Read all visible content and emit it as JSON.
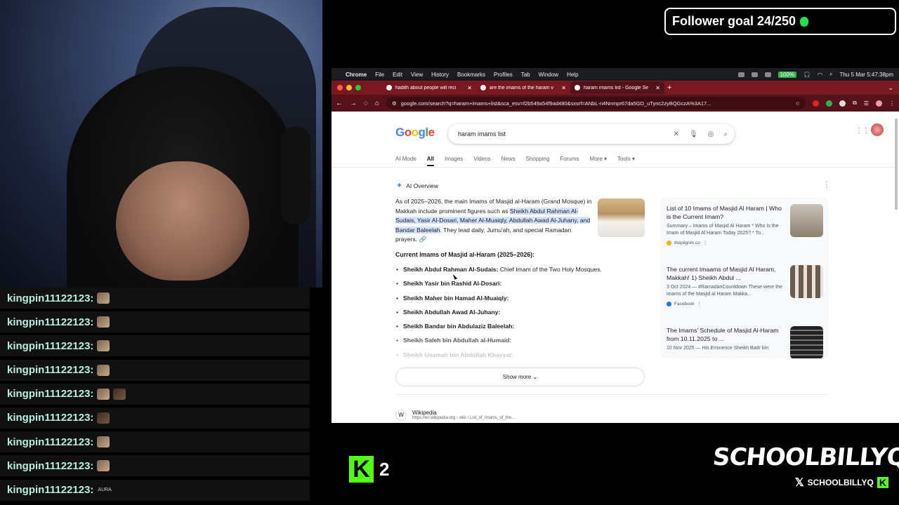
{
  "follower_goal": {
    "label": "Follower goal 24/250",
    "progress": 0.096,
    "color": "#23e04a"
  },
  "chat": {
    "messages": [
      {
        "user": "kingpin11122123:",
        "emote": "face"
      },
      {
        "user": "kingpin11122123:",
        "emote": "face"
      },
      {
        "user": "kingpin11122123:",
        "emote": "face"
      },
      {
        "user": "kingpin11122123:",
        "emote": "face"
      },
      {
        "user": "kingpin11122123:",
        "emote": "face-pair"
      },
      {
        "user": "kingpin11122123:",
        "emote": "dark-face"
      },
      {
        "user": "kingpin11122123:",
        "emote": "brown-face"
      },
      {
        "user": "kingpin11122123:",
        "emote": "face"
      },
      {
        "user": "kingpin11122123:",
        "emote_text": "AURA"
      }
    ]
  },
  "kick": {
    "count": "2",
    "logo": "K",
    "color": "#53fc18"
  },
  "brand": {
    "name": "SCHOOLBILLYQ",
    "handle": "SCHOOLBILLYQ",
    "kick_glyph": "K"
  },
  "mac_menubar": {
    "app": "Chrome",
    "items": [
      "File",
      "Edit",
      "View",
      "History",
      "Bookmarks",
      "Profiles",
      "Tab",
      "Window",
      "Help"
    ],
    "battery": "100%",
    "datetime": "Thu 5 Mar 5:47:38pm"
  },
  "tabs": [
    {
      "title": "hadith about people will reci",
      "active": false
    },
    {
      "title": "are the imams of the haram v",
      "active": false
    },
    {
      "title": "haram imams list - Google Se",
      "active": true
    }
  ],
  "address_bar": {
    "url": "google.com/search?q=haram+imams+list&sca_esv=f2b549a54f9ad480&sxsrf=ANbL-n4Nnmpr67da5GD_uTync2zyBQGczA%3A17..."
  },
  "search": {
    "query": "haram imams list",
    "tabs": [
      "AI Mode",
      "All",
      "Images",
      "Videos",
      "News",
      "Shopping",
      "Forums",
      "More",
      "Tools"
    ],
    "active_tab": "All"
  },
  "ai_overview": {
    "label": "AI Overview",
    "intro": "As of 2025–2026, the main Imams of Masjid al-Haram (Grand Mosque) in Makkah include prominent figures such as ",
    "highlight": "Sheikh Abdul Rahman Al-Sudais, Yasir Al-Dosari, Maher Al-Muaiqly, Abdullah Awad Al-Juhany, and Bandar Baleelah",
    "outro": ". They lead daily, Jumu'ah, and special Ramadan prayers.",
    "current_heading": "Current Imams of Masjid al-Haram (2025–2026):",
    "imams": [
      {
        "name": "Sheikh Abdul Rahman Al-Sudais:",
        "desc": " Chief Imam of the Two Holy Mosques."
      },
      {
        "name": "Sheikh Yasir bin Rashid Al-Dosari:",
        "desc": ""
      },
      {
        "name": "Sheikh Maher bin Hamad Al-Muaiqly:",
        "desc": ""
      },
      {
        "name": "Sheikh Abdullah Awad Al-Juhany:",
        "desc": ""
      },
      {
        "name": "Sheikh Bandar bin Abdulaziz Baleelah:",
        "desc": ""
      },
      {
        "name": "Sheikh Saleh bin Abdullah al-Humaid:",
        "desc": ""
      },
      {
        "name": "Sheikh Usamah bin Abdullah Khayyat:",
        "desc": ""
      }
    ],
    "show_more": "Show more"
  },
  "sources": [
    {
      "title": "List of 10 Imams of Masjid Al Haram | Who is the Current Imam?",
      "snippet": "Summary – Imams of Masjid Al Haram * Who Is the Imam of Masjid Al Haram Today 2025? * To...",
      "site": "thepilgrim.co",
      "site_color": "#f4b400"
    },
    {
      "title": "The current Imaams of Masjid Al Haram, Makkah! 1) Sheikh Abdul ...",
      "snippet": "3 Oct 2024 — #RamadanCountdown These were the imams of the Masjid al Haram Makka...",
      "site": "Facebook",
      "site_color": "#1877f2"
    },
    {
      "title": "The Imams' Schedule of Masjid Al-Haram from 10.11.2025 to ...",
      "snippet": "10 Nov 2025 — His Eminence Sheikh Badr bin",
      "site": "",
      "site_color": ""
    }
  ],
  "wiki": {
    "name": "Wikipedia",
    "url": "https://en.wikipedia.org › wiki › List_of_Imams_of_the..."
  }
}
